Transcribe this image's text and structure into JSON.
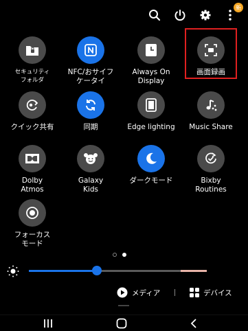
{
  "header": {
    "icons": [
      "search-icon",
      "power-icon",
      "settings-icon",
      "more-icon"
    ],
    "badge": "新"
  },
  "tiles": [
    {
      "label": "セキュリティ\nフォルダ",
      "icon": "secure-folder-icon",
      "active": false
    },
    {
      "label": "NFC/おサイフ\nケータイ",
      "icon": "nfc-icon",
      "active": true
    },
    {
      "label": "Always On\nDisplay",
      "icon": "always-on-display-icon",
      "active": false
    },
    {
      "label": "画面録画",
      "icon": "screen-recorder-icon",
      "active": false
    },
    {
      "label": "クイック共有",
      "icon": "quick-share-icon",
      "active": false
    },
    {
      "label": "同期",
      "icon": "sync-icon",
      "active": true
    },
    {
      "label": "Edge lighting",
      "icon": "edge-lighting-icon",
      "active": false
    },
    {
      "label": "Music Share",
      "icon": "music-share-icon",
      "active": false
    },
    {
      "label": "Dolby\nAtmos",
      "icon": "dolby-atmos-icon",
      "active": false
    },
    {
      "label": "Galaxy\nKids",
      "icon": "galaxy-kids-icon",
      "active": false
    },
    {
      "label": "ダークモード",
      "icon": "dark-mode-icon",
      "active": true
    },
    {
      "label": "Bixby\nRoutines",
      "icon": "bixby-routines-icon",
      "active": false
    },
    {
      "label": "フォーカス\nモード",
      "icon": "focus-mode-icon",
      "active": false
    }
  ],
  "pager": {
    "pages": 2,
    "current": 2
  },
  "brightness": {
    "level": 0.35,
    "icon": "brightness-icon"
  },
  "bottom": {
    "media_label": "メディア",
    "devices_label": "デバイス"
  },
  "colors": {
    "accent": "#1a73e8",
    "tile_bg": "#4a4a4a",
    "highlight": "#e02020",
    "badge": "#f5a623"
  }
}
